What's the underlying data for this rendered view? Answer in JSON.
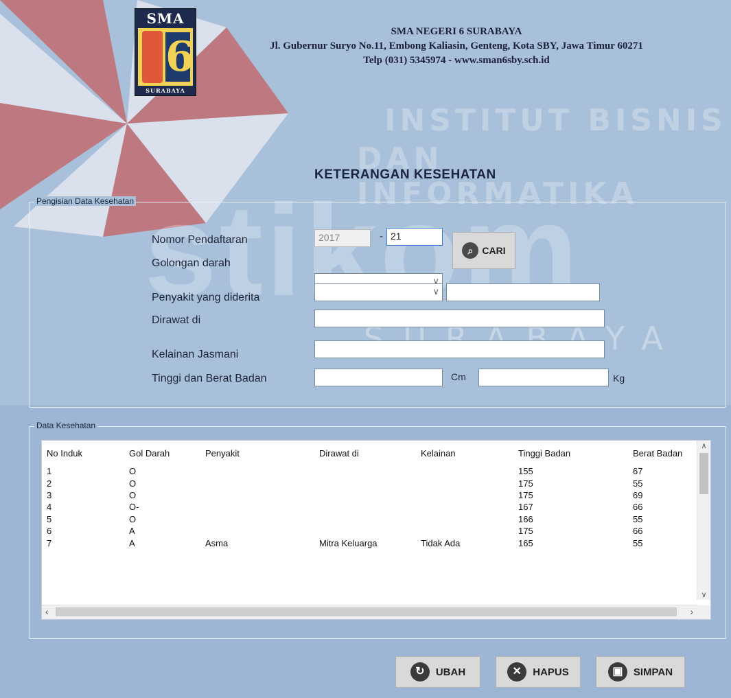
{
  "watermark": {
    "line1": "INSTITUT BISNIS",
    "line2": "DAN INFORMATIKA",
    "brand": "stikom",
    "city": "SURABAYA"
  },
  "logo": {
    "top": "SMA",
    "number": "6",
    "bottom": "SURABAYA"
  },
  "school": {
    "name": "SMA NEGERI 6 SURABAYA",
    "address": "Jl. Gubernur Suryo No.11, Embong Kaliasin, Genteng, Kota SBY, Jawa Timur 60271",
    "contact": "Telp (031) 5345974 - www.sman6sby.sch.id"
  },
  "page_title": "KETERANGAN KESEHATAN",
  "form": {
    "group_label": "Pengisian Data Kesehatan",
    "labels": {
      "nomor": "Nomor Pendaftaran",
      "golongan": "Golongan darah",
      "penyakit": "Penyakit yang diderita",
      "dirawat": "Dirawat di",
      "kelainan": "Kelainan Jasmani",
      "tinggi_berat": "Tinggi dan Berat Badan"
    },
    "year_value": "2017",
    "dash": "-",
    "nomor_value": "21",
    "golongan_value": "",
    "penyakit_value": "",
    "penyakit_text": "",
    "dirawat_value": "",
    "kelainan_value": "",
    "tinggi_value": "",
    "berat_value": "",
    "unit_cm": "Cm",
    "unit_kg": "Kg",
    "cari_label": "CARI",
    "search_icon": "search-icon",
    "dropdown_icon": "chevron-down-icon"
  },
  "table": {
    "group_label": "Data Kesehatan",
    "columns": [
      "No Induk",
      "Gol Darah",
      "Penyakit",
      "Dirawat di",
      "Kelainan",
      "Tinggi Badan",
      "Berat Badan"
    ],
    "rows": [
      [
        "1",
        "O",
        "",
        "",
        "",
        "155",
        "67"
      ],
      [
        "2",
        "O",
        "",
        "",
        "",
        "175",
        "55"
      ],
      [
        "3",
        "O",
        "",
        "",
        "",
        "175",
        "69"
      ],
      [
        "4",
        "O-",
        "",
        "",
        "",
        "167",
        "66"
      ],
      [
        "5",
        "O",
        "",
        "",
        "",
        "166",
        "55"
      ],
      [
        "6",
        "A",
        "",
        "",
        "",
        "175",
        "66"
      ],
      [
        "7",
        "A",
        "Asma",
        "Mitra Keluarga",
        "Tidak Ada",
        "165",
        "55"
      ]
    ]
  },
  "actions": {
    "ubah": "UBAH",
    "hapus": "HAPUS",
    "simpan": "SIMPAN"
  },
  "colors": {
    "background": "#a9c0da",
    "watermark_red": "#c9302c",
    "button": "#d9d9d9"
  }
}
